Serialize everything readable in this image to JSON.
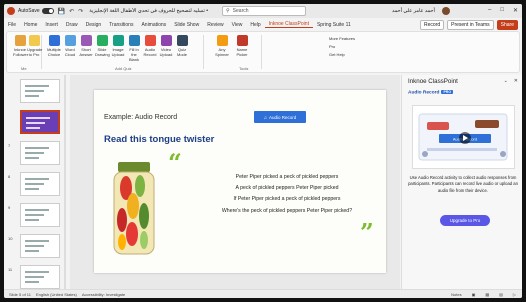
{
  "titlebar": {
    "autosave": "AutoSave",
    "doc_title": "تسليه لتصحيح للحروف في تحدي الأطفال اللغة الإنجليزية • Saved to this PC",
    "search_placeholder": "Search",
    "user_name": "أحمد عامر علي أحمد"
  },
  "menu": {
    "tabs": [
      "File",
      "Home",
      "Insert",
      "Draw",
      "Design",
      "Transitions",
      "Animations",
      "Slide Show",
      "Review",
      "View",
      "Help",
      "Inknoe ClassPoint",
      "Spring Suite 11"
    ],
    "active_index": 11,
    "record_label": "Record",
    "present_label": "Present in Teams",
    "share_label": "Share"
  },
  "ribbon": {
    "tools": [
      "Inknoe Follower",
      "Upgrade to Pro",
      "Multiple Choice",
      "Word Cloud",
      "Short Answer",
      "Slide Drawing",
      "Image Upload",
      "Fill in the Blank",
      "Audio Record",
      "Video Upload",
      "Quiz Mode",
      "Any Spinner",
      "Name Picker"
    ],
    "group_labels": [
      "Me",
      "Add Quiz",
      "Tools"
    ],
    "more_features": "More Features",
    "pro_label": "Pro",
    "get_help": "Get Help"
  },
  "thumbnails": {
    "numbers": [
      "",
      "",
      "7",
      "8",
      "9",
      "10",
      "11"
    ],
    "selected_index": 1
  },
  "slide": {
    "example_label": "Example: Audio Record",
    "audio_button": "Audio Record",
    "title": "Read this tongue twister",
    "quote_open": "“",
    "quote_close": "”",
    "lines": [
      "Peter Piper picked a peck of pickled peppers",
      "A peck of pickled peppers Peter Piper picked",
      "If Peter Piper picked a peck of pickled peppers",
      "Where's the peck of pickled peppers Peter Piper picked?"
    ]
  },
  "panel": {
    "title": "Inknoe ClassPoint",
    "subtitle": "Audio Record",
    "badge": "PRO",
    "preview_button": "Audio Record",
    "description": "Use Audio Record activity to collect audio responses from participants. Participants can record live audio or upload an audio file from their device.",
    "upgrade_label": "Upgrade to Pro"
  },
  "statusbar": {
    "slide_info": "Slide 5 of 11",
    "language": "English (United States)",
    "accessibility": "Accessibility: Investigate",
    "notes": "Notes"
  },
  "colors": {
    "accent": "#c43e1c",
    "title_blue": "#1d3f86",
    "quote_green": "#7dbb2f",
    "button_blue": "#2e6fd8",
    "upgrade_purple": "#5b57e6"
  }
}
